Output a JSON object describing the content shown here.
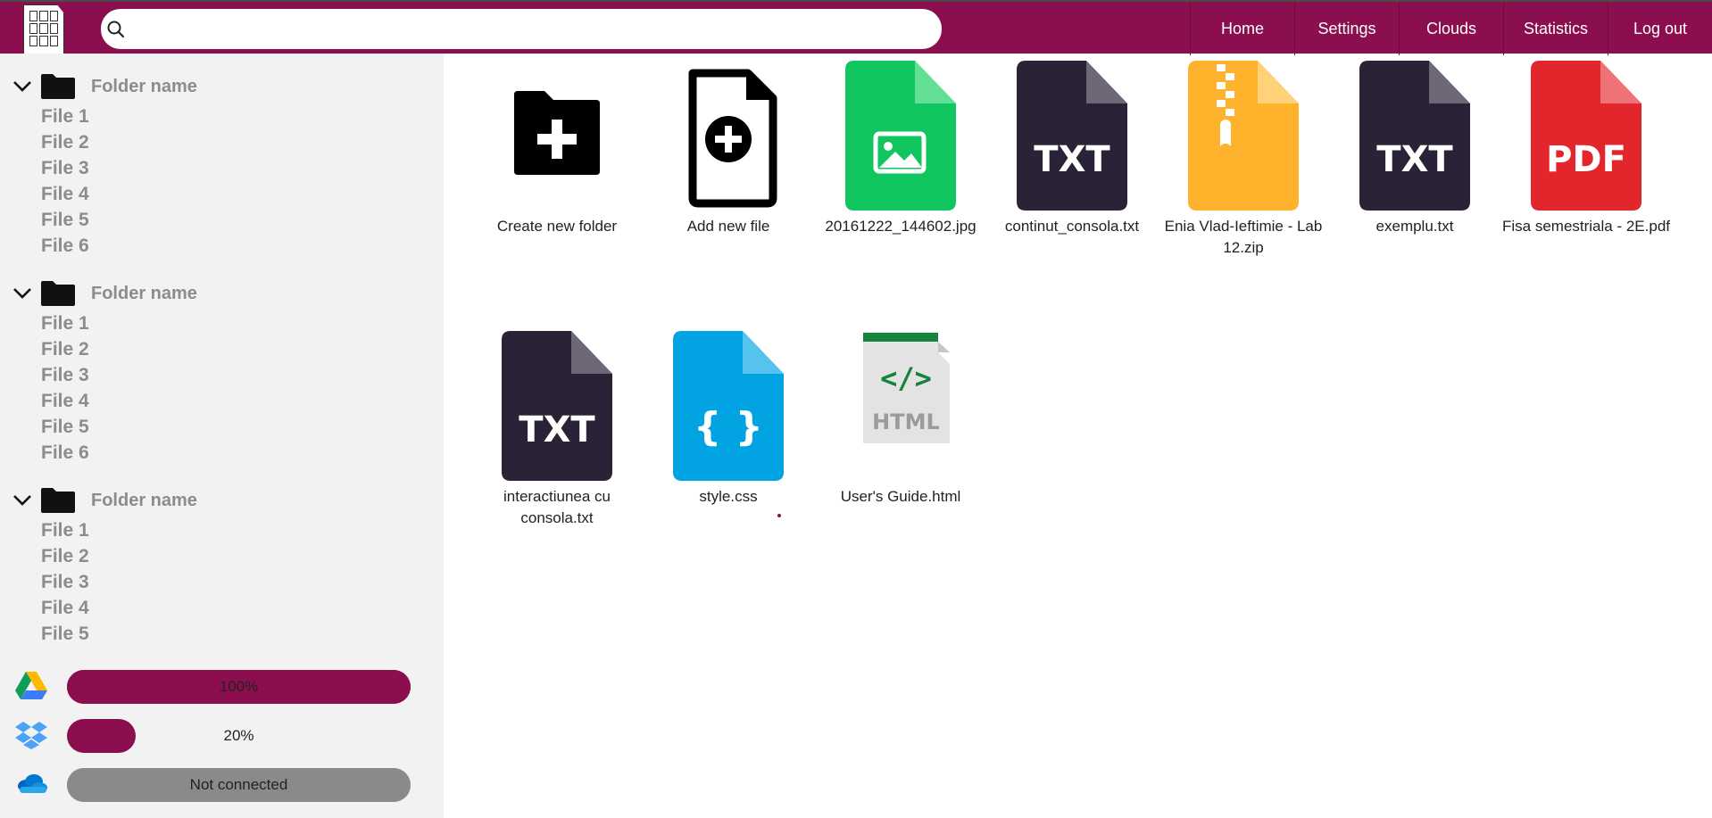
{
  "header": {
    "search": {
      "placeholder": "",
      "value": ""
    },
    "nav": [
      {
        "label": "Home"
      },
      {
        "label": "Settings"
      },
      {
        "label": "Clouds"
      },
      {
        "label": "Statistics"
      },
      {
        "label": "Log out"
      }
    ]
  },
  "sidebar": {
    "folders": [
      {
        "name": "Folder name",
        "files": [
          "File 1",
          "File 2",
          "File 3",
          "File 4",
          "File 5",
          "File 6"
        ]
      },
      {
        "name": "Folder name",
        "files": [
          "File 1",
          "File 2",
          "File 3",
          "File 4",
          "File 5",
          "File 6"
        ]
      },
      {
        "name": "Folder name",
        "files": [
          "File 1",
          "File 2",
          "File 3",
          "File 4",
          "File 5"
        ]
      }
    ],
    "clouds": [
      {
        "icon": "google-drive-icon",
        "progress": 100,
        "text": "100%",
        "fill": "#8b0e4f",
        "track": "#8b0e4f"
      },
      {
        "icon": "dropbox-icon",
        "progress": 20,
        "text": "20%",
        "fill": "#8b0e4f",
        "track": "transparent"
      },
      {
        "icon": "onedrive-icon",
        "progress": 100,
        "text": "Not connected",
        "fill": "#8a8a8a",
        "track": "#8a8a8a"
      }
    ]
  },
  "main": {
    "tiles": [
      {
        "icon": "create-folder-icon",
        "label": "Create new folder"
      },
      {
        "icon": "add-file-icon",
        "label": "Add new file"
      },
      {
        "icon": "image-file-icon",
        "label": "20161222_144602.jpg"
      },
      {
        "icon": "txt-file-icon",
        "label": "continut_consola.txt",
        "badge": "TXT"
      },
      {
        "icon": "zip-file-icon",
        "label": "Enia Vlad-Ieftimie - Lab 12.zip"
      },
      {
        "icon": "txt-file-icon",
        "label": "exemplu.txt",
        "badge": "TXT"
      },
      {
        "icon": "pdf-file-icon",
        "label": "Fisa semestriala - 2E.pdf",
        "badge": "PDF"
      },
      {
        "icon": "txt-file-icon",
        "label": "interactiunea cu consola.txt",
        "badge": "TXT"
      },
      {
        "icon": "css-file-icon",
        "label": "style.css",
        "badge": "{ }"
      },
      {
        "icon": "html-file-icon",
        "label": "User's Guide.html",
        "badge": "HTML"
      }
    ]
  },
  "colors": {
    "accent": "#8b0e4f",
    "txt": "#2a2236",
    "image": "#11c55f",
    "zip": "#ffb22c",
    "pdf": "#e2262b",
    "css": "#02a3e2"
  }
}
